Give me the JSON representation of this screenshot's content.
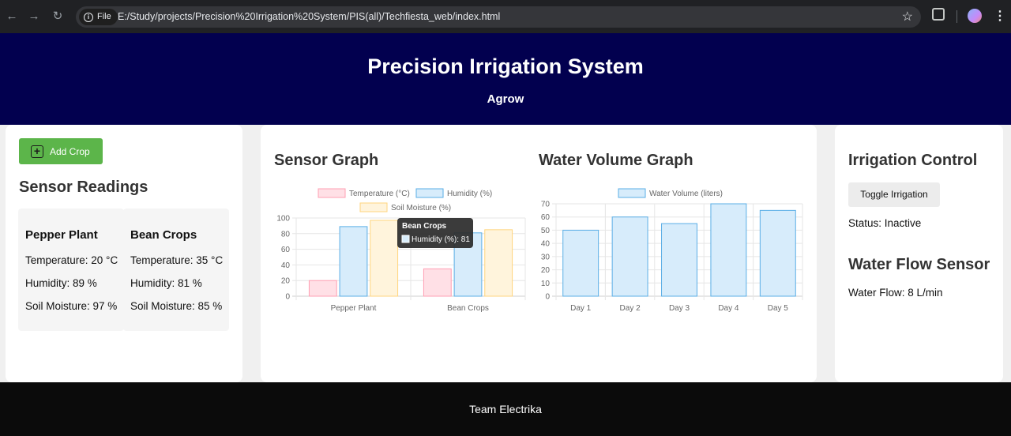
{
  "browser": {
    "back_icon": "arrow-left-icon",
    "forward_icon": "arrow-right-icon",
    "reload_icon": "reload-icon",
    "security_chip": "File",
    "url": "E:/Study/projects/Precision%20Irrigation%20System/PIS(all)/Techfiesta_web/index.html"
  },
  "header": {
    "title": "Precision Irrigation System",
    "subtitle": "Agrow"
  },
  "left_panel": {
    "add_crop_label": "Add Crop",
    "section_title": "Sensor Readings",
    "crops": [
      {
        "name": "Pepper Plant",
        "temperature": "Temperature: 20 °C",
        "humidity": "Humidity: 89 %",
        "soil": "Soil Moisture: 97 %"
      },
      {
        "name": "Bean Crops",
        "temperature": "Temperature: 35 °C",
        "humidity": "Humidity: 81 %",
        "soil": "Soil Moisture: 85 %"
      }
    ]
  },
  "sensor_graph": {
    "title": "Sensor Graph",
    "tooltip": {
      "title": "Bean Crops",
      "text": "Humidity (%): 81"
    }
  },
  "water_graph": {
    "title": "Water Volume Graph"
  },
  "right_panel": {
    "irrigation_title": "Irrigation Control",
    "toggle_label": "Toggle Irrigation",
    "status_text": "Status: Inactive",
    "flow_title": "Water Flow Sensor",
    "flow_text": "Water Flow: 8 L/min"
  },
  "footer": {
    "text": "Team Electrika"
  },
  "colors": {
    "header_bg": "#02004f",
    "add_button": "#5cb54a",
    "temperature_fill": "#ffe0e6",
    "temperature_border": "#ff9fb3",
    "humidity_fill": "#d7ecfb",
    "humidity_border": "#5aaee6",
    "soil_fill": "#fff4dc",
    "soil_border": "#ffd57e"
  },
  "chart_data": [
    {
      "type": "bar",
      "categories": [
        "Pepper Plant",
        "Bean Crops"
      ],
      "series": [
        {
          "name": "Temperature (°C)",
          "values": [
            20,
            35
          ]
        },
        {
          "name": "Humidity (%)",
          "values": [
            89,
            81
          ]
        },
        {
          "name": "Soil Moisture (%)",
          "values": [
            97,
            85
          ]
        }
      ],
      "ylim": [
        0,
        100
      ],
      "yticks": [
        0,
        20,
        40,
        60,
        80,
        100
      ],
      "legend": "top",
      "grid": true
    },
    {
      "type": "bar",
      "categories": [
        "Day 1",
        "Day 2",
        "Day 3",
        "Day 4",
        "Day 5"
      ],
      "series": [
        {
          "name": "Water Volume (liters)",
          "values": [
            50,
            60,
            55,
            70,
            65
          ]
        }
      ],
      "ylim": [
        0,
        70
      ],
      "yticks": [
        0,
        10,
        20,
        30,
        40,
        50,
        60,
        70
      ],
      "legend": "top",
      "grid": true
    }
  ]
}
